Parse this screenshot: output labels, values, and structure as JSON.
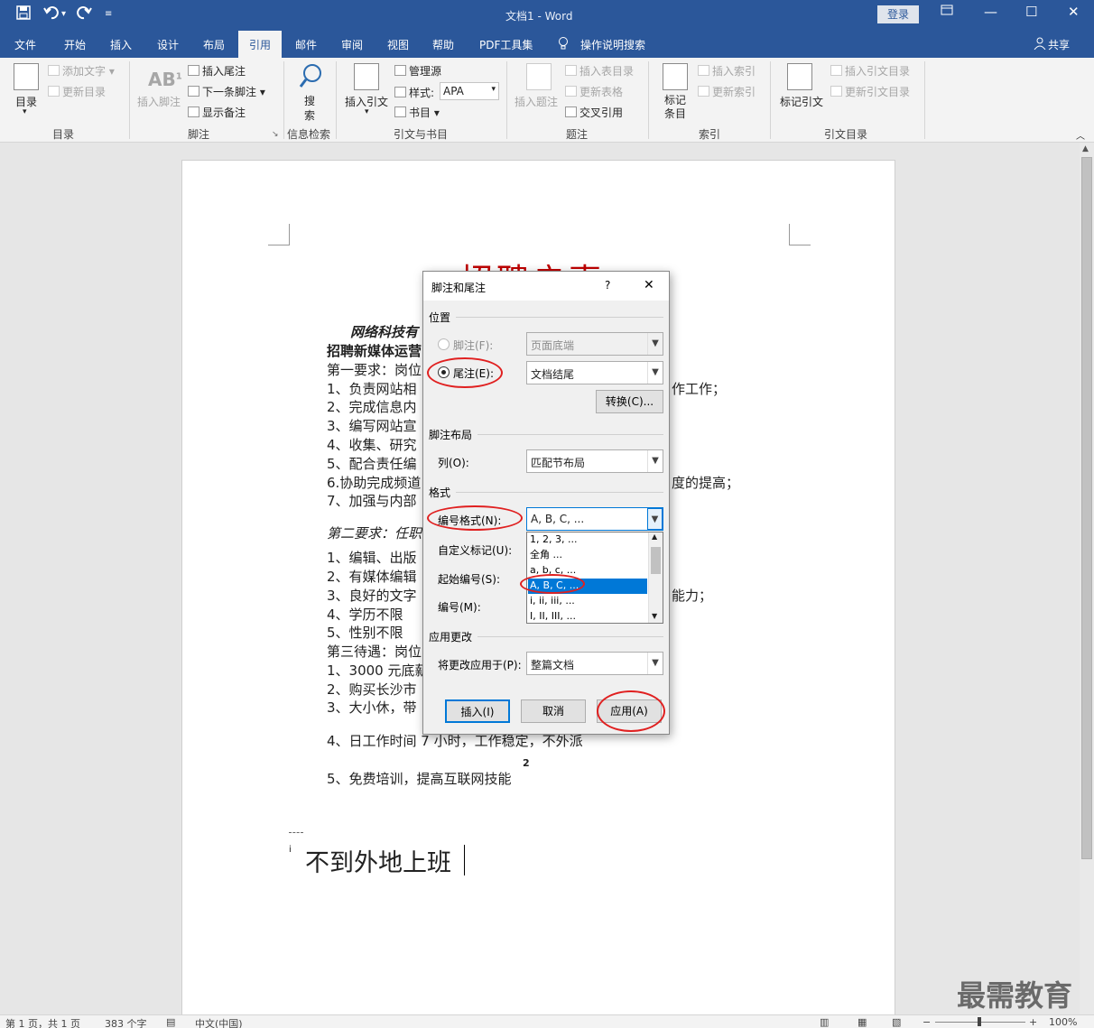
{
  "app": {
    "window_title": "文档1  -  Word",
    "login_label": "登录",
    "share_label": "共享",
    "qat": {
      "save_icon": "save-icon",
      "undo_icon": "undo-icon",
      "redo_icon": "redo-icon",
      "customize_icon": "customize-qat-icon"
    }
  },
  "tabs": [
    "文件",
    "开始",
    "插入",
    "设计",
    "布局",
    "引用",
    "邮件",
    "审阅",
    "视图",
    "帮助",
    "PDF工具集"
  ],
  "active_tab": "引用",
  "tell_me": "操作说明搜索",
  "ribbon": {
    "toc": {
      "big": "目录",
      "add_text": "添加文字",
      "update_toc": "更新目录",
      "group": "目录"
    },
    "footnotes": {
      "insert_footnote": "插入脚注",
      "insert_endnote": "插入尾注",
      "next_footnote": "下一条脚注",
      "show_notes": "显示备注",
      "group": "脚注"
    },
    "research": {
      "search": "搜索",
      "group": "信息检索"
    },
    "citations": {
      "insert_citation": "插入引文",
      "manage_sources": "管理源",
      "style_label": "样式:",
      "style_value": "APA",
      "bibliography": "书目",
      "group": "引文与书目"
    },
    "captions": {
      "insert_caption": "插入题注",
      "insert_table_of_figures": "插入表目录",
      "update_table": "更新表格",
      "cross_reference": "交叉引用",
      "group": "题注"
    },
    "index": {
      "mark_entry": "标记条目",
      "insert_index": "插入索引",
      "update_index": "更新索引",
      "group": "索引"
    },
    "toa": {
      "mark_citation": "标记引文",
      "insert_toa": "插入引文目录",
      "update_toa": "更新引文目录",
      "group": "引文目录"
    }
  },
  "document": {
    "title": "招聘启事",
    "lines": [
      "网络科技有",
      "招聘新媒体运营",
      "第一要求：岗位",
      "1、负责网站相",
      "2、完成信息内",
      "3、编写网站宣",
      "4、收集、研究",
      "5、配合责任编",
      "6.协助完成频道",
      "7、加强与内部",
      "第二要求：任职",
      "1、编辑、出版",
      "2、有媒体编辑",
      "3、良好的文字",
      "4、学历不限",
      "5、性别不限",
      "第三待遇：岗位",
      "1、3000 元底薪",
      "2、购买长沙市",
      "3、大小休，带",
      "4、日工作时间 7 小时，工作稳定，不外派",
      "5、免费培训，提高互联网技能"
    ],
    "right_fragments": [
      "作工作；",
      "度的提高；",
      "能力；"
    ],
    "endnote_ref": "2",
    "endnote_mark": "i",
    "endnote_text": "不到外地上班"
  },
  "dialog": {
    "title": "脚注和尾注",
    "help": "?",
    "close": "✕",
    "position_label": "位置",
    "footnote_label": "脚注(F):",
    "footnote_value": "页面底端",
    "endnote_label": "尾注(E):",
    "endnote_value": "文档结尾",
    "convert": "转换(C)...",
    "layout_label": "脚注布局",
    "columns_label": "列(O):",
    "columns_value": "匹配节布局",
    "format_label": "格式",
    "number_format_label": "编号格式(N):",
    "number_format_value": "A, B, C, ...",
    "custom_mark_label": "自定义标记(U):",
    "start_at_label": "起始编号(S):",
    "numbering_label": "编号(M):",
    "format_options": [
      "1, 2, 3, ...",
      "全角 ...",
      "a, b, c, ...",
      "A, B, C, ...",
      "i, ii, iii, ...",
      "I, II, III, ..."
    ],
    "selected_option": "A, B, C, ...",
    "apply_changes_label": "应用更改",
    "apply_to_label": "将更改应用于(P):",
    "apply_to_value": "整篇文档",
    "insert": "插入(I)",
    "cancel": "取消",
    "apply": "应用(A)"
  },
  "status": {
    "page": "第 1 页，共 1 页",
    "words": "383 个字",
    "language": "中文(中国)",
    "zoom": "100%"
  },
  "watermark": "最需教育",
  "colors": {
    "word_blue": "#2b579a",
    "title_red": "#c00000",
    "annotation_red": "#e02020",
    "selection": "#0078d7"
  }
}
